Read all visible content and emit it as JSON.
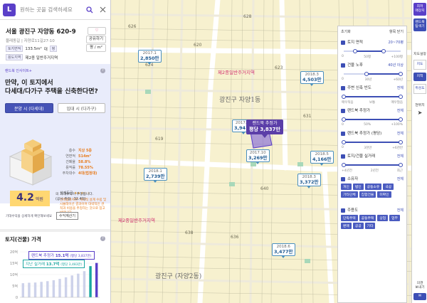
{
  "search": {
    "logo": "L",
    "placeholder": "원하는 곳을 검색하세요"
  },
  "address": {
    "title": "서울 광진구 자양동 620-9",
    "sub": "물레동길  |  자양로11길27-10",
    "tag1": "토지면적",
    "area": "133.5m²",
    "land_type": "대",
    "use_label": "용도지역",
    "zone": "제2종 일반주거지역",
    "btn_compare": "공유하기",
    "btn_price": "평 / m²",
    "area_unit": "평"
  },
  "promo": {
    "tag": "랜드북 인사이트+",
    "question": "만약, 이 토지에서\n다세대/다가구 주택을 신축한다면?",
    "toggle_sale": "분양 시 (다세대)",
    "toggle_rent": "임대 시 (다가구)",
    "info": [
      {
        "k": "층수",
        "v": "지상 5층"
      },
      {
        "k": "연면적",
        "v": "514m²"
      },
      {
        "k": "건폐율",
        "v": "58.8%"
      },
      {
        "k": "용적률",
        "v": "78.55%"
      },
      {
        "k": "주차대수",
        "v": "4대(법정대)"
      }
    ],
    "grade_label": "설계등급",
    "stars": "★★★☆☆",
    "desc": "건축법에 따른 개략적 설계 수립 및 시뮬레이션 결과이며 대략적인 견적과 비용을 추정하는 것으로 참고 바랍니다.",
    "price": "4.2",
    "price_unit": "억원",
    "price_note": "의 기대수익이 추정됩니다.\n(공시 추정 : 32.4억)",
    "foot_text": "기대수익을 상세하게 확인해보세요",
    "foot_btn": "수익계산기"
  },
  "chart": {
    "title": "토지(건물) 가격",
    "legend_main_label": "랜드북 추정가",
    "legend_main_value": "15.1억",
    "legend_main_note": "(평당 3,837만)",
    "legend_sub_label": "지난 실거래",
    "legend_sub_value": "13.7억",
    "legend_sub_note": "(평당 3,483만)"
  },
  "chart_data": {
    "type": "bar",
    "categories": [
      "",
      "",
      "",
      "",
      "",
      "",
      "",
      "",
      "",
      "",
      "",
      "",
      ""
    ],
    "y_ticks": [
      "20억",
      "15억",
      "10억",
      "5억",
      "0"
    ],
    "series": [
      {
        "name": "랜드북 추정가",
        "values": [
          6.2,
          6.4,
          6.5,
          6.8,
          7.1,
          7.5,
          8.1,
          8.8,
          9.6,
          10.4,
          11.5,
          13.7,
          15.1
        ]
      }
    ],
    "ylim": [
      0,
      20
    ]
  },
  "map": {
    "place1": "광진구\n자양1동",
    "place2": "광진구\n(자양2동)",
    "label1": "제2종일반주거지역",
    "label2": "제2종일반주거지역",
    "main_pin": {
      "label": "랜드북 추정가",
      "price": "평당 3,837만"
    },
    "pins": [
      {
        "year": "2017.1",
        "price": "2,850만"
      },
      {
        "year": "2018.3",
        "price": "4,503만"
      },
      {
        "year": "2017.12",
        "price": "3,941만"
      },
      {
        "year": "2017.10",
        "price": "3,269만"
      },
      {
        "year": "2018.1",
        "price": "2,739만"
      },
      {
        "year": "2018.3",
        "price": "3,372만"
      },
      {
        "year": "2018.5",
        "price": "4,166만"
      },
      {
        "year": "2018.6",
        "price": "3,477만"
      }
    ]
  },
  "filter": {
    "head_left": "초기화",
    "head_right": "항목 닫기",
    "items": [
      {
        "label": "토지 면적",
        "value": "20~70평",
        "ticks": [
          "0",
          "50평",
          "+100평"
        ]
      },
      {
        "label": "건물 노후",
        "value": "40년 이상",
        "ticks": [
          "0",
          "30년",
          "+60년"
        ]
      },
      {
        "label": "주변 신축 빈도",
        "value": "전체",
        "ticks": [
          "매우적음",
          "보통",
          "매우많음"
        ]
      },
      {
        "label": "랜드북 추정가",
        "value": "전체",
        "ticks": [
          "0",
          "50%",
          "+100%"
        ]
      },
      {
        "label": "랜드북 추정가 (평당)",
        "value": "전체",
        "ticks": [
          "0",
          "3천만",
          "+6천만"
        ]
      },
      {
        "label": "토지/건물 실거래",
        "value": "전체",
        "ticks": [
          "+4년전",
          "2년전",
          "최근"
        ]
      }
    ],
    "owner_label": "소유자",
    "owner_value": "전체",
    "owner_chips": [
      "개인",
      "법인",
      "공동소유",
      "국공",
      "기타단체",
      "집합건물",
      "미확인"
    ],
    "use_label": "주용도",
    "use_value": "전체",
    "use_chips": [
      "단독주택",
      "공동주택",
      "상업",
      "업무",
      "판매",
      "공공",
      "기타"
    ]
  },
  "tools": {
    "t1": "최저\n매장지",
    "t2": "랜드북\n탐색기",
    "t3": "지도설정",
    "t4": "지도",
    "t5": "지적",
    "t6": "위성도",
    "t7": "현위치",
    "t8": "의견\n보내기"
  },
  "colors": {
    "accent": "#5a3fc8",
    "blue": "#3d4fb5",
    "orange": "#e87c1c",
    "map_bg": "#f7f1cf"
  }
}
